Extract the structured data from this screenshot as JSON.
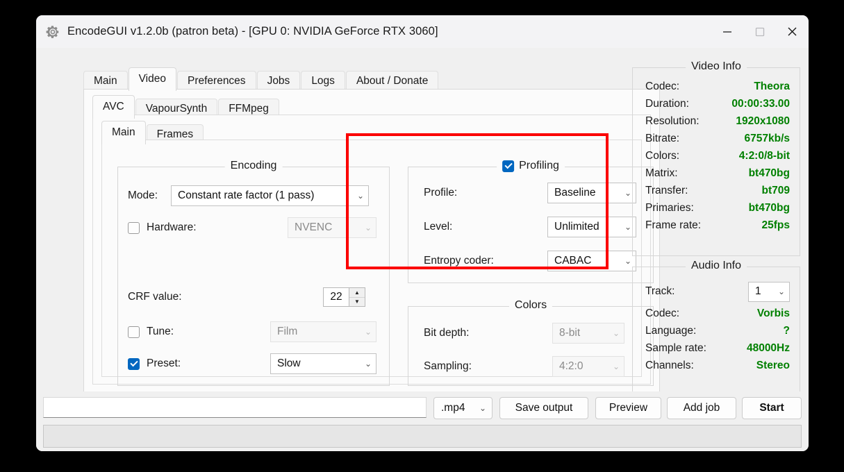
{
  "window": {
    "title": "EncodeGUI v1.2.0b (patron beta) - [GPU 0: NVIDIA GeForce RTX 3060]",
    "app_icon": "gear-icon",
    "controls": {
      "minimize": "—",
      "maximize": "▢",
      "close": "✕"
    }
  },
  "tabs_level1": [
    {
      "label": "Main",
      "active": false
    },
    {
      "label": "Video",
      "active": true
    },
    {
      "label": "Preferences",
      "active": false
    },
    {
      "label": "Jobs",
      "active": false
    },
    {
      "label": "Logs",
      "active": false
    },
    {
      "label": "About / Donate",
      "active": false
    }
  ],
  "tabs_level2": [
    {
      "label": "AVC",
      "active": true
    },
    {
      "label": "VapourSynth",
      "active": false
    },
    {
      "label": "FFMpeg",
      "active": false
    }
  ],
  "tabs_level3": [
    {
      "label": "Main",
      "active": true
    },
    {
      "label": "Frames",
      "active": false
    }
  ],
  "encoding": {
    "legend": "Encoding",
    "mode_label": "Mode:",
    "mode_value": "Constant rate factor (1 pass)",
    "hardware_label": "Hardware:",
    "hardware_checked": false,
    "hardware_value": "NVENC",
    "hardware_enabled": false,
    "crf_label": "CRF value:",
    "crf_value": "22",
    "tune_label": "Tune:",
    "tune_checked": false,
    "tune_value": "Film",
    "tune_enabled": false,
    "preset_label": "Preset:",
    "preset_checked": true,
    "preset_value": "Slow",
    "preset_enabled": true
  },
  "profiling": {
    "legend": "Profiling",
    "checked": true,
    "highlight_color": "#fb0000",
    "profile_label": "Profile:",
    "profile_value": "Baseline",
    "level_label": "Level:",
    "level_value": "Unlimited",
    "entropy_label": "Entropy coder:",
    "entropy_value": "CABAC"
  },
  "colors": {
    "legend": "Colors",
    "bit_depth_label": "Bit depth:",
    "bit_depth_value": "8-bit",
    "bit_depth_enabled": false,
    "sampling_label": "Sampling:",
    "sampling_value": "4:2:0",
    "sampling_enabled": false
  },
  "video_info": {
    "legend": "Video Info",
    "value_color": "#008000",
    "rows": [
      {
        "key": "Codec:",
        "value": "Theora"
      },
      {
        "key": "Duration:",
        "value": "00:00:33.00"
      },
      {
        "key": "Resolution:",
        "value": "1920x1080"
      },
      {
        "key": "Bitrate:",
        "value": "6757kb/s"
      },
      {
        "key": "Colors:",
        "value": "4:2:0/8-bit"
      },
      {
        "key": "Matrix:",
        "value": "bt470bg"
      },
      {
        "key": "Transfer:",
        "value": "bt709"
      },
      {
        "key": "Primaries:",
        "value": "bt470bg"
      },
      {
        "key": "Frame rate:",
        "value": "25fps"
      }
    ]
  },
  "audio_info": {
    "legend": "Audio Info",
    "track_label": "Track:",
    "track_value": "1",
    "rows": [
      {
        "key": "Codec:",
        "value": "Vorbis"
      },
      {
        "key": "Language:",
        "value": "?"
      },
      {
        "key": "Sample rate:",
        "value": "48000Hz"
      },
      {
        "key": "Channels:",
        "value": "Stereo"
      }
    ]
  },
  "bottom": {
    "path_value": "",
    "container_value": ".mp4",
    "save_output_label": "Save output",
    "preview_label": "Preview",
    "add_job_label": "Add job",
    "start_label": "Start",
    "status_text": ""
  }
}
